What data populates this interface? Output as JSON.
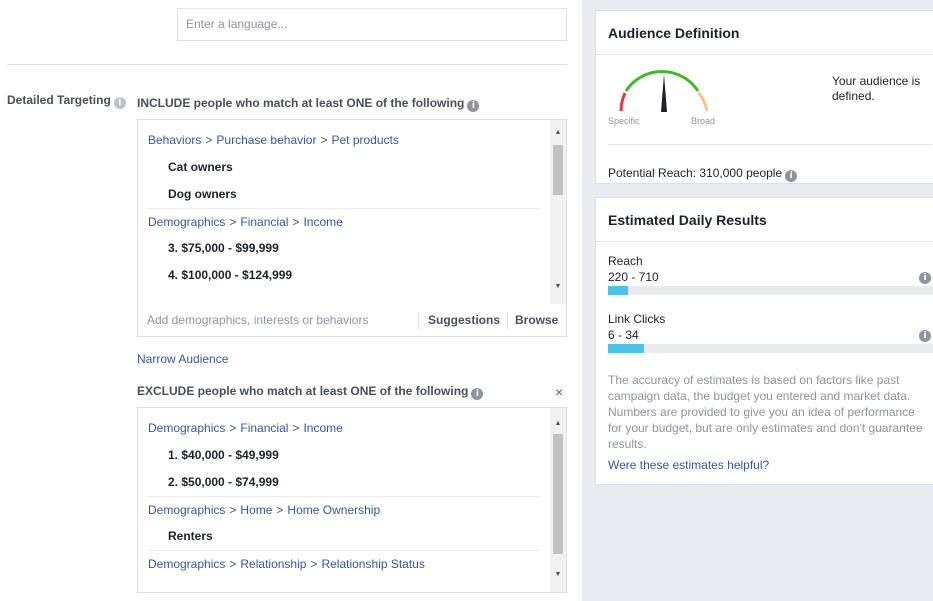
{
  "language": {
    "placeholder": "Enter a language..."
  },
  "detailed_targeting": {
    "label": "Detailed Targeting",
    "include": {
      "title": "INCLUDE people who match at least ONE of the following",
      "groups": [
        {
          "path": [
            "Behaviors",
            "Purchase behavior",
            "Pet products"
          ],
          "items": [
            "Cat owners",
            "Dog owners"
          ]
        },
        {
          "path": [
            "Demographics",
            "Financial",
            "Income"
          ],
          "items": [
            "3. $75,000 - $99,999",
            "4. $100,000 - $124,999"
          ]
        }
      ],
      "add_placeholder": "Add demographics, interests or behaviors",
      "suggestions_label": "Suggestions",
      "browse_label": "Browse"
    },
    "narrow_label": "Narrow Audience",
    "exclude": {
      "title": "EXCLUDE people who match at least ONE of the following",
      "close": "×",
      "groups": [
        {
          "path": [
            "Demographics",
            "Financial",
            "Income"
          ],
          "items": [
            "1. $40,000 - $49,999",
            "2. $50,000 - $74,999"
          ]
        },
        {
          "path": [
            "Demographics",
            "Home",
            "Home Ownership"
          ],
          "items": [
            "Renters"
          ]
        },
        {
          "path": [
            "Demographics",
            "Relationship",
            "Relationship Status"
          ],
          "items": []
        }
      ]
    }
  },
  "audience": {
    "title": "Audience Definition",
    "gauge_specific": "Specific",
    "gauge_broad": "Broad",
    "status": "Your audience is defined.",
    "potential_reach": "Potential Reach: 310,000 people"
  },
  "results": {
    "title": "Estimated Daily Results",
    "metrics": [
      {
        "name": "Reach",
        "value": "220 - 710",
        "fill_fraction": 0.06
      },
      {
        "name": "Link Clicks",
        "value": "6 - 34",
        "fill_fraction": 0.11
      }
    ],
    "disclaimer": "The accuracy of estimates is based on factors like past campaign data, the budget you entered and market data. Numbers are provided to give you an idea of performance for your budget, but are only estimates and don't guarantee results.",
    "helpful_link": "Were these estimates helpful?"
  },
  "colors": {
    "link": "#365899",
    "bar_fill": "#4ec2e5",
    "gauge_green": "#42b72a",
    "gauge_red": "#e0393e",
    "gauge_peach": "#f7c08d"
  }
}
